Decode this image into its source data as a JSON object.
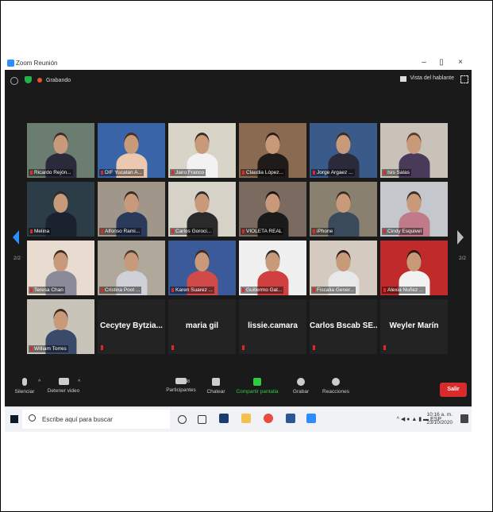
{
  "window": {
    "title": "Zoom Reunión",
    "minimize": "–",
    "maximize": "▯",
    "close": "×"
  },
  "topbar": {
    "recording": "Grabando",
    "speaker_view": "Vista del hablante"
  },
  "pagination": {
    "left": "2/2",
    "right": "2/2"
  },
  "participants": [
    {
      "name": "Ricardo Rejón...",
      "video": true
    },
    {
      "name": "DIF Yucatan A...",
      "video": true
    },
    {
      "name": "Jairo Franco",
      "video": true
    },
    {
      "name": "Claudia López...",
      "video": true
    },
    {
      "name": "Jorge Argaez ...",
      "video": true
    },
    {
      "name": "Isis Salas",
      "video": true
    },
    {
      "name": "Melina",
      "video": true
    },
    {
      "name": "Alfonso Rami...",
      "video": true
    },
    {
      "name": "Carlos Goroci...",
      "video": true
    },
    {
      "name": "VIOLETA REAL",
      "video": true
    },
    {
      "name": "iPhone",
      "video": true
    },
    {
      "name": "Cindy Esquivel",
      "video": true
    },
    {
      "name": "Teresa Chan",
      "video": true
    },
    {
      "name": "Cristina Poot ...",
      "video": true
    },
    {
      "name": "Karen Suarez ...",
      "video": true
    },
    {
      "name": "Guillermo Gal...",
      "video": true
    },
    {
      "name": "Fiscalia Gener...",
      "video": true
    },
    {
      "name": "Alexia Nuñez ...",
      "video": true
    },
    {
      "name": "William Torres",
      "video": true
    },
    {
      "name": "Cecytey  Bytzia...",
      "video": false
    },
    {
      "name": "maria gil",
      "video": false
    },
    {
      "name": "lissie.camara",
      "video": false
    },
    {
      "name": "Carlos Bscab SE...",
      "video": false
    },
    {
      "name": "Weyler Marín",
      "video": false
    }
  ],
  "toolbar": {
    "mute": "Silenciar",
    "stop_video": "Detener video",
    "participants": "Participantes",
    "participants_count": "48",
    "chat": "Chatear",
    "share": "Compartir pantalla",
    "record": "Grabar",
    "reactions": "Reacciones",
    "leave": "Salir",
    "caret": "^"
  },
  "taskbar": {
    "search_placeholder": "Escribe aquí para buscar",
    "lang": "ESP",
    "time": "10:16 a. m.",
    "date": "23/10/2020",
    "notif_count": "3"
  },
  "colors": {
    "accent": "#2d8cff",
    "leave": "#d92b2b",
    "share": "#2ecc40",
    "recording": "#e8542f"
  }
}
